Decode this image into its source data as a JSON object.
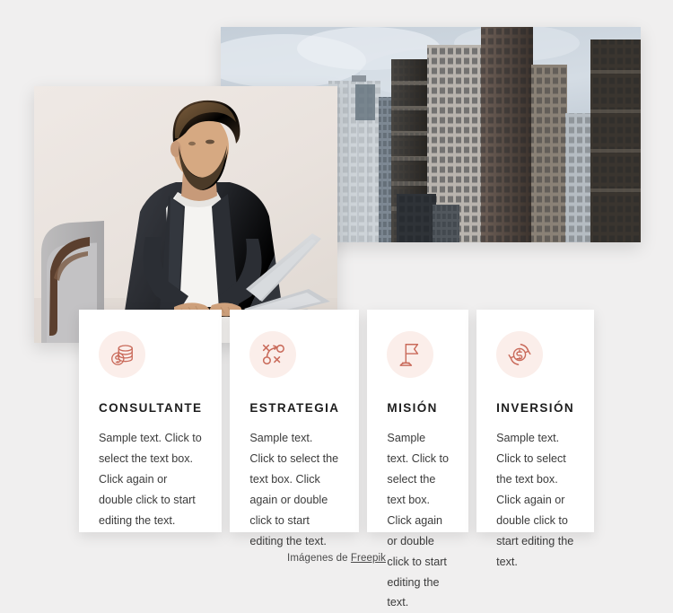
{
  "page": {
    "background_color": "#f0efef"
  },
  "media": {
    "city_photo": {
      "alt": "Modern city skyline with glass office skyscrapers under a cloudy sky",
      "name": "city-skyline-photo"
    },
    "person_photo": {
      "alt": "Bearded businessman in dark blazer and white t-shirt typing on a laptop in a grey armchair",
      "name": "businessman-laptop-photo"
    }
  },
  "cards": [
    {
      "icon": "coins-stack-icon",
      "title": "CONSULTANTE",
      "body": "Sample text. Click to select the text box. Click again or double click to start editing the text."
    },
    {
      "icon": "strategy-playbook-icon",
      "title": "ESTRATEGIA",
      "body": "Sample text. Click to select the text box. Click again or double click to start editing the text."
    },
    {
      "icon": "flag-icon",
      "title": "MISIÓN",
      "body": "Sample text. Click to select the text box. Click again or double click to start editing the text."
    },
    {
      "icon": "money-return-icon",
      "title": "INVERSIÓN",
      "body": "Sample text. Click to select the text box. Click again or double click to start editing the text."
    }
  ],
  "footer": {
    "prefix": "Imágenes de ",
    "link_label": "Freepik"
  },
  "colors": {
    "icon_accent": "#c96a5a",
    "icon_circle_bg": "#fbeeea",
    "card_bg": "#ffffff",
    "title_color": "#1d1d1d",
    "body_color": "#3b3b3b"
  }
}
